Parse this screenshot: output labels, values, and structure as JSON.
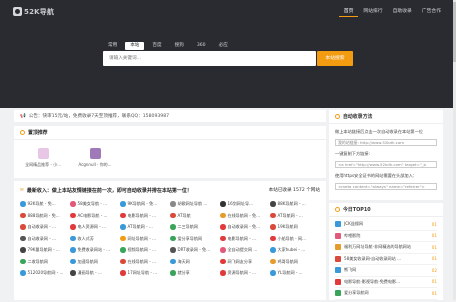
{
  "brand": {
    "logo_text": "52K导航"
  },
  "topnav": [
    "首页",
    "网站排行",
    "自助收录",
    "广告合作"
  ],
  "search": {
    "tabs": [
      "常用",
      "本站",
      "百度",
      "搜狗",
      "360",
      "必应"
    ],
    "active_tab": 1,
    "placeholder": "请输入关键词...",
    "button": "本站搜索"
  },
  "notice": {
    "icon": "megaphone-icon",
    "text": "公告：快审15元/站，免费收录7天至顶推荐，联系QQ：158093987"
  },
  "recommend": {
    "title": "置顶推荐",
    "items": [
      {
        "label": "全网精品推荐 - 小...",
        "color": "#e8c7e6"
      },
      {
        "label": "Acgnnull - 你的...",
        "color": "#a07ab8"
      }
    ]
  },
  "latest": {
    "title": "最新收入：做上本站友情链接在前一次，即可自动收录并排在本站第一位！",
    "count_label": "本站已收录 1572 个网站",
    "sites": [
      [
        "92K导航 - 免...",
        "#3a9ad9"
      ],
      [
        "58美女导航 - ...",
        "#e25a7a"
      ],
      [
        "9K导航网 - 免...",
        "#3a9ad9"
      ],
      [
        "胡歌网址导航 ...",
        "#888"
      ],
      [
        "16剑网址导...",
        "#333"
      ],
      [
        "88K导航网 - ...",
        "#444"
      ],
      [
        "888导航网 - 免...",
        "#d94a3a"
      ],
      [
        "AC电影导航 - ...",
        "#e23a3a"
      ],
      [
        "电影导航网 - ...",
        "#e23a3a"
      ],
      [
        "AT导航",
        "#d94a3a"
      ],
      [
        "在线导航网 - 免...",
        "#e69b2a"
      ],
      [
        "AT导航网 - ...",
        "#d94a3a"
      ],
      [
        "自动收录网 - ...",
        "#d94a3a"
      ],
      [
        "电人资源网 - ...",
        "#e23a3a"
      ],
      [
        "AT导航网 - ...",
        "#3a9ad9"
      ],
      [
        "二三导航网",
        "#3aa55a"
      ],
      [
        "自动收录网 - 免...",
        "#e23a3a"
      ],
      [
        "19K导航网",
        "#d94a3a"
      ],
      [
        "自动收录网 - ...",
        "#555"
      ],
      [
        "收人式芳",
        "#3a9ad9"
      ],
      [
        "网址导航网 - ...",
        "#f39c12"
      ],
      [
        "爱分享导航网",
        "#3aa55a"
      ],
      [
        "电影导航网 - ...",
        "#e23a3a"
      ],
      [
        "小船导航 - 网...",
        "#e23a3a"
      ],
      [
        "79K量导航网 - ...",
        "#444"
      ],
      [
        "免费收录网站 - ...",
        "#3a9ad9"
      ],
      [
        "视频导航网 - ...",
        "#3aa55a"
      ],
      [
        "DRT收录网 - 免...",
        "#555"
      ],
      [
        "全自动提交网 ...",
        "#e25a7a"
      ],
      [
        "大家hubei - ...",
        "#3a9ad9"
      ],
      [
        "二收导航网",
        "#3aa55a"
      ],
      [
        "加速导航网",
        "#3a9ad9"
      ],
      [
        "在线导航网 - ...",
        "#d94a3a"
      ],
      [
        "海天网",
        "#3a9ad9"
      ],
      [
        "网飞网友分享",
        "#e23a3a"
      ],
      [
        "鸡哥导航网",
        "#e69b2a"
      ],
      [
        "512020导航网 - ...",
        "#3a9ad9"
      ],
      [
        "漫画导航 - ...",
        "#444"
      ],
      [
        "17网址导航 - ...",
        "#e23a3a"
      ],
      [
        "就分享",
        "#3aa55a"
      ],
      [
        "资源导航网 - ...",
        "#e23a3a"
      ],
      [
        "YL导航网 - ...",
        "#3a9ad9"
      ]
    ]
  },
  "auto": {
    "title": "自动收录方法",
    "text1": "做上本站链接后点击一次自动收录在本站第一位",
    "input1": "我的站链接: http://www.52kdh.com",
    "text2": "一键复制下方链接:",
    "input2": "<a href=\"http://www.52kdh.com\" target=\"_b",
    "text3": "使用https安全证书的网站需要在头部加入：",
    "input3": "<meta content=\"always\" name=\"referrer\">"
  },
  "top10": {
    "title": "今日TOP10",
    "items": [
      {
        "name": "JCK益搜网",
        "count": "01",
        "color": "#3a9ad9"
      },
      {
        "name": "哔哩影院",
        "count": "01",
        "color": "#e25a7a"
      },
      {
        "name": "福利万网址导航-非网精选的导航网站",
        "count": "01",
        "color": "#e69b2a"
      },
      {
        "name": "58美女收录网-自动收录网站 ...",
        "count": "01",
        "color": "#d94a3a"
      },
      {
        "name": "熊飞网",
        "count": "02",
        "color": "#3a9ad9"
      },
      {
        "name": "电影导航-影视导航-免费电影...",
        "count": "01",
        "color": "#e23a3a"
      },
      {
        "name": "爱分享导航网",
        "count": "01",
        "color": "#3aa55a"
      }
    ]
  }
}
